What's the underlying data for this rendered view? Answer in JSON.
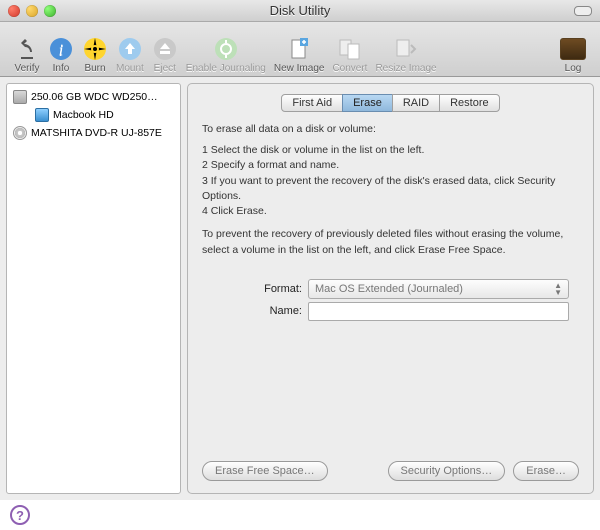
{
  "window": {
    "title": "Disk Utility"
  },
  "toolbar": {
    "verify": "Verify",
    "info": "Info",
    "burn": "Burn",
    "mount": "Mount",
    "eject": "Eject",
    "journal": "Enable Journaling",
    "newimage": "New Image",
    "convert": "Convert",
    "resize": "Resize Image",
    "log": "Log"
  },
  "sidebar": {
    "items": [
      {
        "label": "250.06 GB WDC WD250…",
        "icon": "hdd"
      },
      {
        "label": "Macbook HD",
        "icon": "vol",
        "child": true
      },
      {
        "label": "MATSHITA DVD-R UJ-857E",
        "icon": "optical"
      }
    ]
  },
  "tabs": {
    "firstaid": "First Aid",
    "erase": "Erase",
    "raid": "RAID",
    "restore": "Restore"
  },
  "pane": {
    "intro": "To erase all data on a disk or volume:",
    "step1": "Select the disk or volume in the list on the left.",
    "step2": "Specify a format and name.",
    "step3": "If you want to prevent the recovery of the disk's erased data, click Security Options.",
    "step4": "Click Erase.",
    "p2": "To prevent the recovery of previously deleted files without erasing the volume, select a volume in the list on the left, and click Erase Free Space.",
    "format_label": "Format:",
    "format_value": "Mac OS Extended (Journaled)",
    "name_label": "Name:",
    "name_value": "",
    "btn_freespace": "Erase Free Space…",
    "btn_security": "Security Options…",
    "btn_erase": "Erase…"
  }
}
